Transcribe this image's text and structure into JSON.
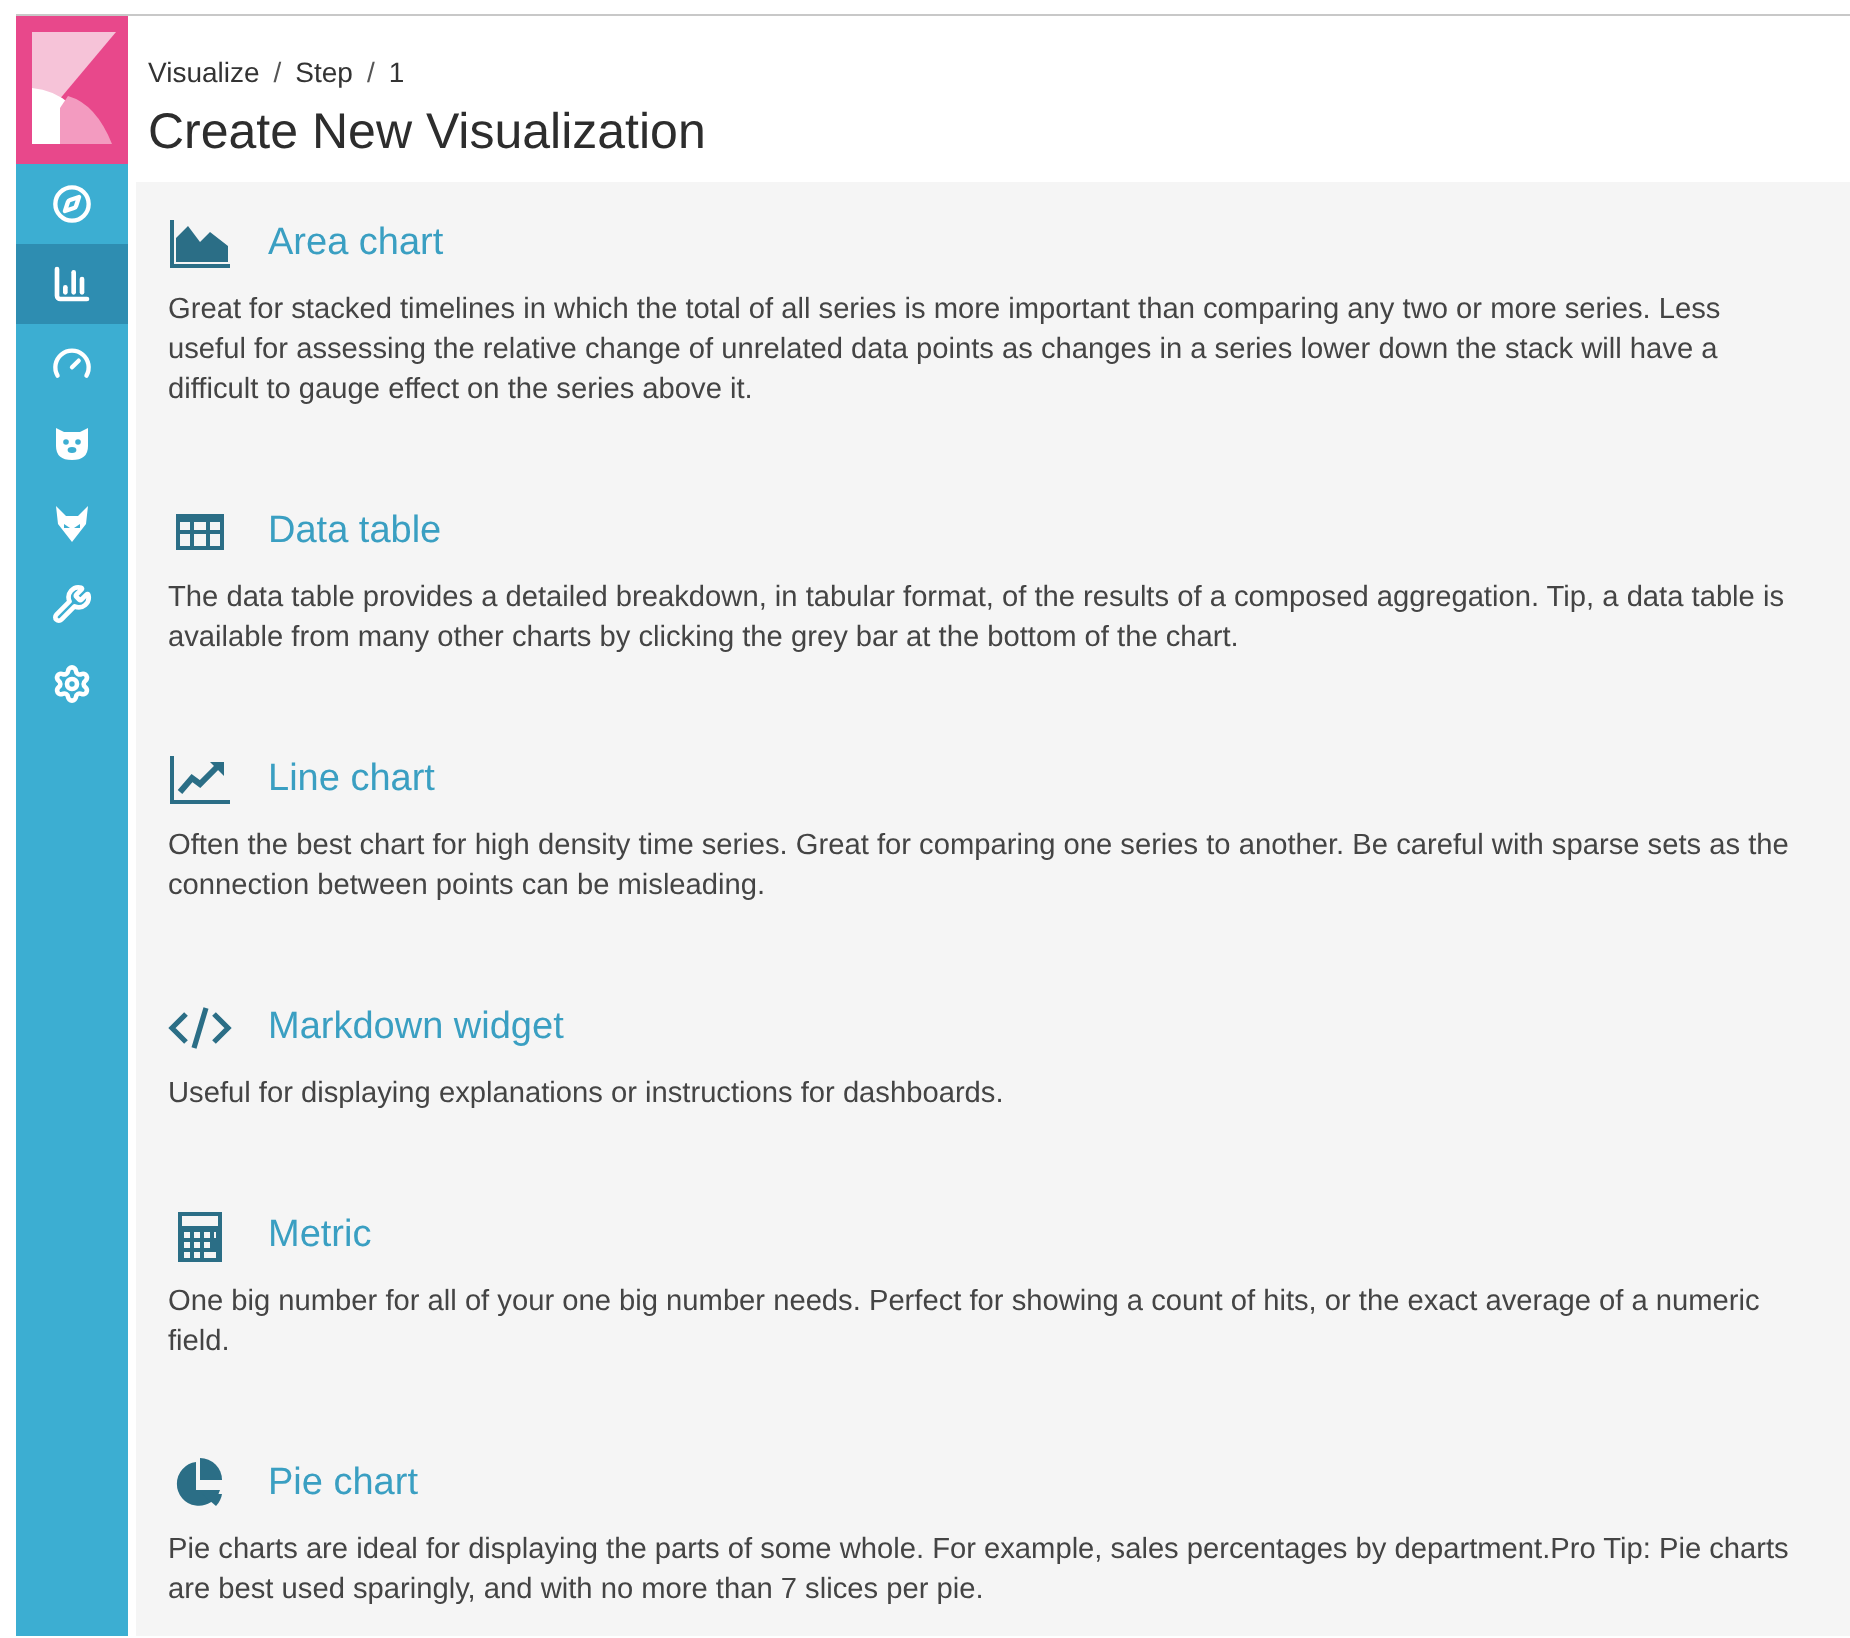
{
  "sidebar": {
    "items": [
      {
        "kind": "compass",
        "selected": false
      },
      {
        "kind": "bar-chart",
        "selected": true
      },
      {
        "kind": "gauge",
        "selected": false
      },
      {
        "kind": "bear",
        "selected": false
      },
      {
        "kind": "fox",
        "selected": false
      },
      {
        "kind": "wrench",
        "selected": false
      },
      {
        "kind": "gear",
        "selected": false
      }
    ]
  },
  "breadcrumb": [
    "Visualize",
    "Step",
    "1"
  ],
  "breadcrumb_separator": "/",
  "title": "Create New Visualization",
  "visualizations": [
    {
      "kind": "area",
      "name": "Area chart",
      "description": "Great for stacked timelines in which the total of all series is more important than comparing any two or more series. Less useful for assessing the relative change of unrelated data points as changes in a series lower down the stack will have a difficult to gauge effect on the series above it."
    },
    {
      "kind": "table",
      "name": "Data table",
      "description": "The data table provides a detailed breakdown, in tabular format, of the results of a composed aggregation. Tip, a data table is available from many other charts by clicking the grey bar at the bottom of the chart."
    },
    {
      "kind": "line",
      "name": "Line chart",
      "description": "Often the best chart for high density time series. Great for comparing one series to another. Be careful with sparse sets as the connection between points can be misleading."
    },
    {
      "kind": "code",
      "name": "Markdown widget",
      "description": "Useful for displaying explanations or instructions for dashboards."
    },
    {
      "kind": "calculator",
      "name": "Metric",
      "description": "One big number for all of your one big number needs. Perfect for showing a count of hits, or the exact average of a numeric field."
    },
    {
      "kind": "pie",
      "name": "Pie chart",
      "description": "Pie charts are ideal for displaying the parts of some whole. For example, sales percentages by department.Pro Tip: Pie charts are best used sparingly, and with no more than 7 slices per pie."
    }
  ]
}
